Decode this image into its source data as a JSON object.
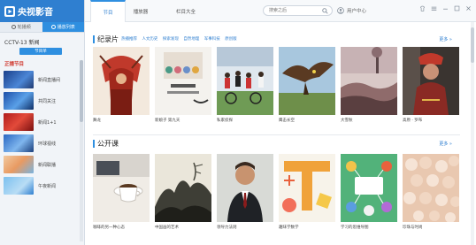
{
  "app": {
    "logo_text": "央视影音",
    "brand_color": "#2f7fd0"
  },
  "sidebar": {
    "tabs": [
      {
        "label": "轮播频"
      },
      {
        "label": "播放列表"
      }
    ],
    "channel_title": "CCTV-13 新闻",
    "channel_button": "节目单",
    "section_label": "正播节目",
    "programs": [
      {
        "label": "新闻直播间"
      },
      {
        "label": "共同关注"
      },
      {
        "label": "新闻1+1"
      },
      {
        "label": "环球视线"
      },
      {
        "label": "新闻联播"
      },
      {
        "label": "午夜新闻"
      }
    ]
  },
  "topbar": {
    "tabs": [
      {
        "label": "节目"
      },
      {
        "label": "播放器"
      },
      {
        "label": "栏目大全"
      }
    ],
    "search": {
      "placeholder": "搜索之后"
    },
    "user_center": "用户中心"
  },
  "sections": [
    {
      "title": "纪录片",
      "subtabs": [
        "热播推荐",
        "人文历史",
        "探索发现",
        "自然地理",
        "军事科技",
        "原创版"
      ],
      "more": "更多",
      "cards": [
        {
          "caption": "舞龙"
        },
        {
          "caption": "新娘子 第九天"
        },
        {
          "caption": "私家侦探"
        },
        {
          "caption": "鹰击长空"
        },
        {
          "caption": "大雪秋"
        },
        {
          "caption": "高原 · 罗布"
        }
      ]
    },
    {
      "title": "公开课",
      "subtabs": [],
      "more": "更多",
      "cards": [
        {
          "caption": "咖啡的另一种心态"
        },
        {
          "caption": "中国画的艺术"
        },
        {
          "caption": "领导力法则"
        },
        {
          "caption": "趣味学数学"
        },
        {
          "caption": "学习的思维导图"
        },
        {
          "caption": "珍珠与时尚"
        }
      ]
    }
  ]
}
